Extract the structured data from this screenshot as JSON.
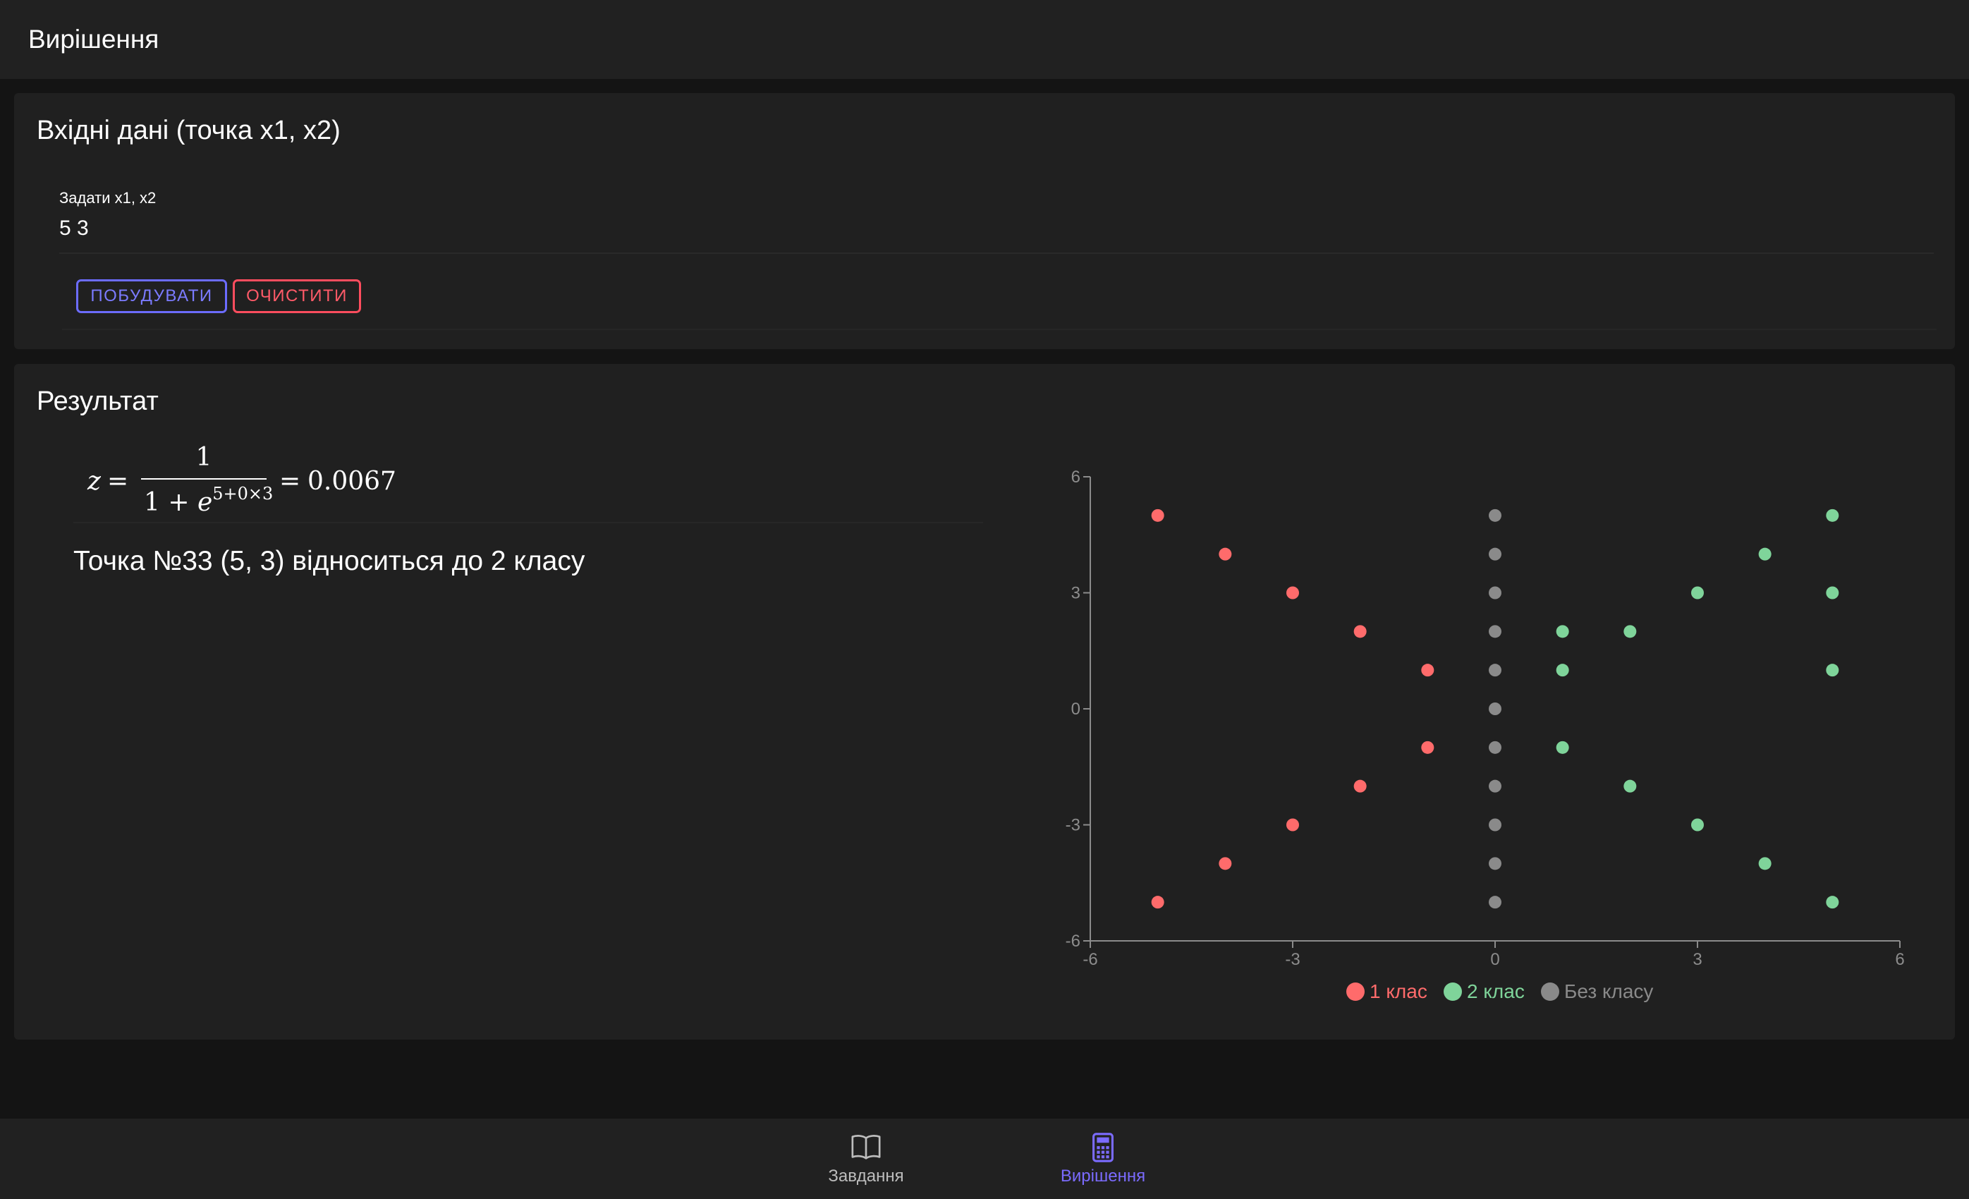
{
  "appbar": {
    "title": "Вирішення"
  },
  "input_card": {
    "title": "Вхідні дані (точка x1, x2)",
    "field_label": "Задати x1, x2",
    "field_value": "5 3",
    "build_label": "ПОБУДУВАТИ",
    "clear_label": "ОЧИСТИТИ"
  },
  "result_card": {
    "title": "Результат",
    "formula": {
      "lhs": "z",
      "eq": "=",
      "numerator": "1",
      "denominator_base": "1 + ",
      "denominator_e": "e",
      "exponent": "5+0×3",
      "value": "0.0067"
    },
    "result_text": "Точка №33 (5, 3) відноситься до 2 класу"
  },
  "colors": {
    "class1": "#ff6b6b",
    "class2": "#7fd49a",
    "none": "#8a8a8a",
    "accent": "#7b6bff",
    "axis": "#8c8c8c"
  },
  "chart_data": {
    "type": "scatter",
    "xlim": [
      -6,
      6
    ],
    "ylim": [
      -6,
      6
    ],
    "x_ticks": [
      "-6",
      "-3",
      "0",
      "3",
      "6"
    ],
    "y_ticks": [
      "6",
      "3",
      "0",
      "-3",
      "-6"
    ],
    "grid": false,
    "legend_position": "bottom",
    "series": [
      {
        "name": "1 клас",
        "color": "#ff6b6b",
        "points": [
          [
            -5,
            5
          ],
          [
            -4,
            4
          ],
          [
            -3,
            3
          ],
          [
            -2,
            2
          ],
          [
            -1,
            1
          ],
          [
            -1,
            -1
          ],
          [
            -2,
            -2
          ],
          [
            -3,
            -3
          ],
          [
            -4,
            -4
          ],
          [
            -5,
            -5
          ]
        ]
      },
      {
        "name": "2 клас",
        "color": "#7fd49a",
        "points": [
          [
            1,
            2
          ],
          [
            2,
            2
          ],
          [
            1,
            1
          ],
          [
            1,
            -1
          ],
          [
            2,
            -2
          ],
          [
            3,
            3
          ],
          [
            4,
            4
          ],
          [
            5,
            5
          ],
          [
            5,
            3
          ],
          [
            5,
            1
          ],
          [
            3,
            -3
          ],
          [
            4,
            -4
          ],
          [
            5,
            -5
          ]
        ]
      },
      {
        "name": "Без класу",
        "color": "#8a8a8a",
        "points": [
          [
            0,
            5
          ],
          [
            0,
            4
          ],
          [
            0,
            3
          ],
          [
            0,
            2
          ],
          [
            0,
            1
          ],
          [
            0,
            0
          ],
          [
            0,
            -1
          ],
          [
            0,
            -2
          ],
          [
            0,
            -3
          ],
          [
            0,
            -4
          ],
          [
            0,
            -5
          ]
        ]
      }
    ]
  },
  "bottom_nav": {
    "tasks_label": "Завдання",
    "solve_label": "Вирішення"
  }
}
